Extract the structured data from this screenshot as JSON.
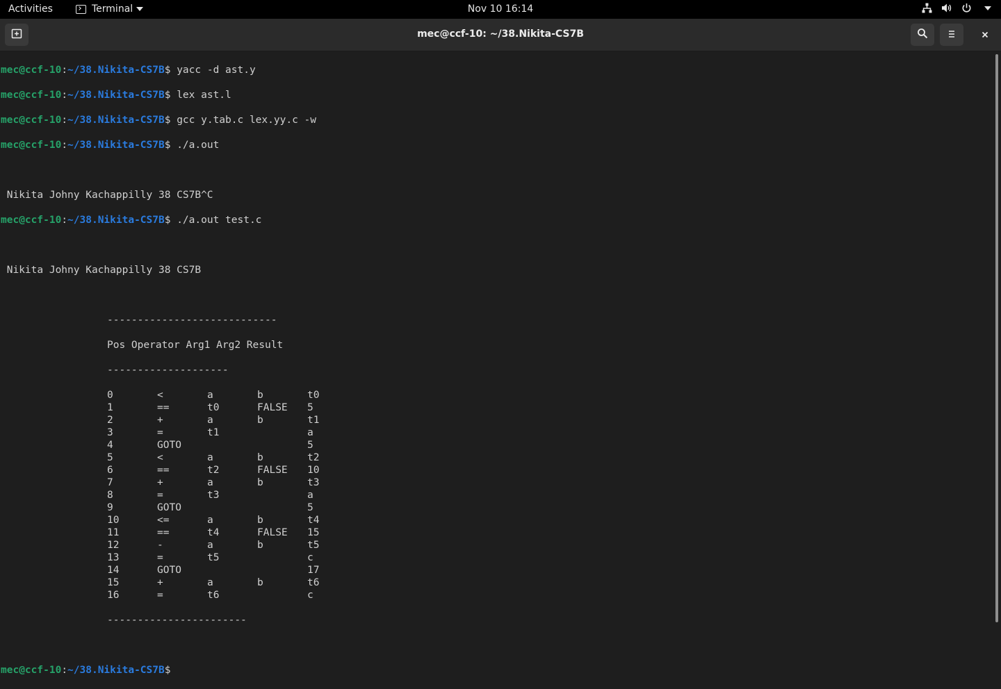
{
  "topbar": {
    "activities": "Activities",
    "app_name": "Terminal",
    "clock": "Nov 10  16:14"
  },
  "window": {
    "title": "mec@ccf-10: ~/38.Nikita-CS7B"
  },
  "prompt": {
    "user": "mec@ccf-10",
    "path": "~/38.Nikita-CS7B",
    "sep": ":",
    "dollar": "$"
  },
  "terminal": {
    "commands": {
      "c1": " yacc -d ast.y",
      "c2": " lex ast.l",
      "c3": " gcc y.tab.c lex.yy.c -w",
      "c4": " ./a.out",
      "c5": " ./a.out test.c",
      "c6": ""
    },
    "output_interrupted": " Nikita Johny Kachappilly 38 CS7B^C",
    "output_name": " Nikita Johny Kachappilly 38 CS7B",
    "table_top_rule": "----------------------------",
    "table_header": "Pos Operator Arg1 Arg2 Result",
    "table_header_rule": "--------------------",
    "table_bottom_rule": "-----------------------",
    "rows": [
      [
        "0",
        "<",
        "a",
        "b",
        "t0"
      ],
      [
        "1",
        "==",
        "t0",
        "FALSE",
        "5"
      ],
      [
        "2",
        "+",
        "a",
        "b",
        "t1"
      ],
      [
        "3",
        "=",
        "t1",
        "",
        "a"
      ],
      [
        "4",
        "GOTO",
        "",
        "",
        "5"
      ],
      [
        "5",
        "<",
        "a",
        "b",
        "t2"
      ],
      [
        "6",
        "==",
        "t2",
        "FALSE",
        "10"
      ],
      [
        "7",
        "+",
        "a",
        "b",
        "t3"
      ],
      [
        "8",
        "=",
        "t3",
        "",
        "a"
      ],
      [
        "9",
        "GOTO",
        "",
        "",
        "5"
      ],
      [
        "10",
        "<=",
        "a",
        "b",
        "t4"
      ],
      [
        "11",
        "==",
        "t4",
        "FALSE",
        "15"
      ],
      [
        "12",
        "-",
        "a",
        "b",
        "t5"
      ],
      [
        "13",
        "=",
        "t5",
        "",
        "c"
      ],
      [
        "14",
        "GOTO",
        "",
        "",
        "17"
      ],
      [
        "15",
        "+",
        "a",
        "b",
        "t6"
      ],
      [
        "16",
        "=",
        "t6",
        "",
        "c"
      ]
    ]
  },
  "icons": {
    "terminal_app": "terminal-icon",
    "network": "network-icon",
    "volume": "volume-icon",
    "power": "power-icon",
    "new_tab": "new-tab-icon",
    "search": "search-icon",
    "menu": "hamburger-menu-icon",
    "close": "close-icon"
  },
  "colors": {
    "prompt_user": "#26a269",
    "prompt_path": "#2a7bde",
    "background": "#1e1e1e",
    "text": "#d0d0d0"
  }
}
